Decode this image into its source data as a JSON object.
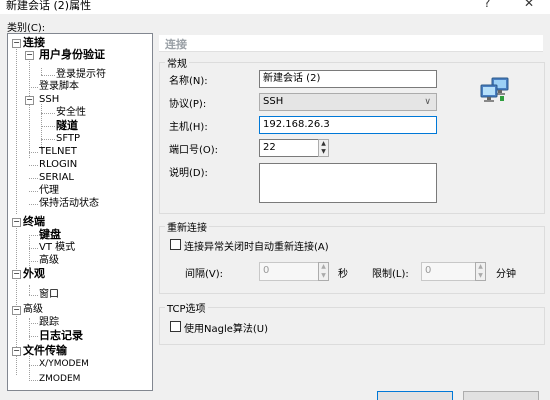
{
  "window": {
    "title": "新建会话 (2)属性",
    "help_glyph": "?",
    "close_glyph": "✕"
  },
  "category_label": "类别(C):",
  "tree": {
    "connection": "连接",
    "user_auth": "用户身份验证",
    "login_prompt": "登录提示符",
    "login_script": "登录脚本",
    "ssh": "SSH",
    "security": "安全性",
    "tunnel": "隧道",
    "sftp": "SFTP",
    "telnet": "TELNET",
    "rlogin": "RLOGIN",
    "serial": "SERIAL",
    "proxy": "代理",
    "keepalive": "保持活动状态",
    "terminal": "终端",
    "keyboard": "键盘",
    "vt_mode": "VT 模式",
    "advanced": "高级",
    "appearance": "外观",
    "window": "窗口",
    "advanced2": "高级",
    "trace": "跟踪",
    "logging": "日志记录",
    "file_transfer": "文件传输",
    "xymodem": "X/YMODEM",
    "zmodem": "ZMODEM"
  },
  "panel": {
    "header": "连接",
    "general": {
      "title": "常规",
      "name_label": "名称(N):",
      "name_value": "新建会话 (2)",
      "protocol_label": "协议(P):",
      "protocol_value": "SSH",
      "host_label": "主机(H):",
      "host_value": "192.168.26.3",
      "port_label": "端口号(O):",
      "port_value": "22",
      "desc_label": "说明(D):",
      "desc_value": ""
    },
    "reconnect": {
      "title": "重新连接",
      "checkbox_label": "连接异常关闭时自动重新连接(A)",
      "interval_label": "间隔(V):",
      "interval_value": "0",
      "interval_unit": "秒",
      "limit_label": "限制(L):",
      "limit_value": "0",
      "limit_unit": "分钟"
    },
    "tcp": {
      "title": "TCP选项",
      "nagle_label": "使用Nagle算法(U)"
    }
  }
}
